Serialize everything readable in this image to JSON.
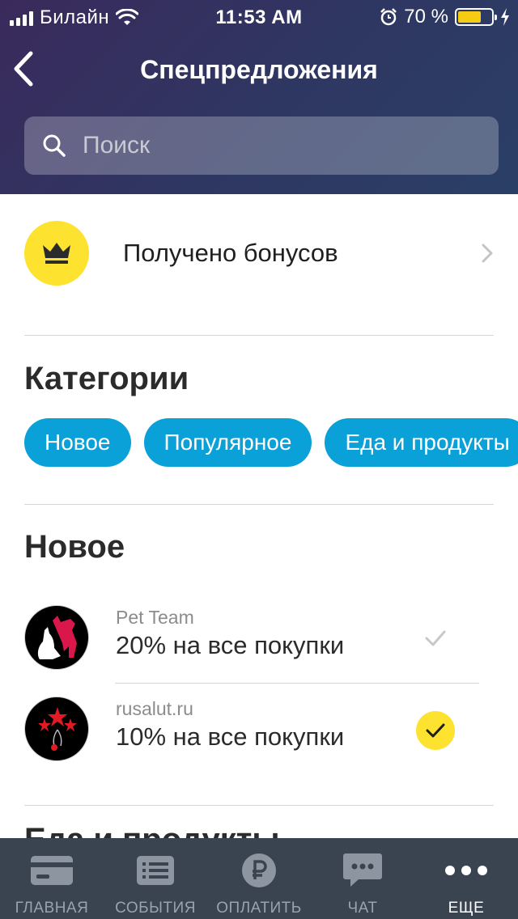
{
  "status_bar": {
    "carrier": "Билайн",
    "time": "11:53 AM",
    "battery_percent": "70 %",
    "battery_level": 0.7
  },
  "nav": {
    "title": "Спецпредложения",
    "back_icon": "chevron-left-icon"
  },
  "search": {
    "placeholder": "Поиск",
    "value": ""
  },
  "bonus": {
    "label": "Получено бонусов",
    "icon": "crown-icon"
  },
  "categories": {
    "title": "Категории",
    "chips": [
      {
        "label": "Новое"
      },
      {
        "label": "Популярное"
      },
      {
        "label": "Еда и продукты"
      }
    ]
  },
  "new_section": {
    "title": "Новое",
    "offers": [
      {
        "source": "Pet Team",
        "title": "20% на все покупки",
        "activated": false
      },
      {
        "source": "rusalut.ru",
        "title": "10% на все покупки",
        "activated": true
      }
    ]
  },
  "next_section": {
    "title": "Еда и продукты"
  },
  "tabbar": {
    "tabs": [
      {
        "label": "ГЛАВНАЯ",
        "icon": "card-icon",
        "active": false
      },
      {
        "label": "СОБЫТИЯ",
        "icon": "list-icon",
        "active": false
      },
      {
        "label": "ОПЛАТИТЬ",
        "icon": "ruble-icon",
        "active": false
      },
      {
        "label": "ЧАТ",
        "icon": "chat-icon",
        "active": false
      },
      {
        "label": "ЕЩЕ",
        "icon": "more-icon",
        "active": true
      }
    ]
  },
  "colors": {
    "accent": "#0aa0d8",
    "yellow": "#fde230",
    "tabbar_bg": "#3a4350"
  }
}
